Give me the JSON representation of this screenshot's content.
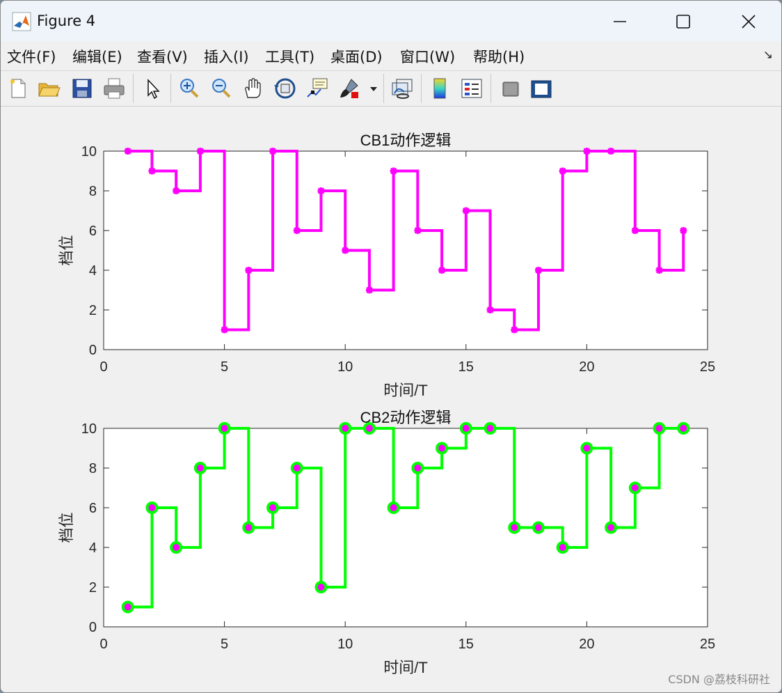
{
  "window": {
    "title": "Figure 4",
    "controls": [
      "minimize",
      "maximize",
      "close"
    ]
  },
  "menu": [
    "文件(F)",
    "编辑(E)",
    "查看(V)",
    "插入(I)",
    "工具(T)",
    "桌面(D)",
    "窗口(W)",
    "帮助(H)"
  ],
  "menu_dock_arrow": "↘",
  "toolbar": [
    "new-figure-icon",
    "open-file-icon",
    "save-icon",
    "print-icon",
    "select-arrow-icon",
    "zoom-in-icon",
    "zoom-out-icon",
    "pan-hand-icon",
    "rotate-3d-icon",
    "data-cursor-icon",
    "brush-icon",
    "link-plot-icon",
    "colorbar-icon",
    "legend-icon",
    "hide-plot-tools-icon",
    "show-plot-tools-icon"
  ],
  "watermark": "CSDN @荔枝科研社",
  "chart_data": [
    {
      "type": "line",
      "step": true,
      "title": "CB1动作逻辑",
      "xlabel": "时间/T",
      "ylabel": "档位",
      "xlim": [
        0,
        25
      ],
      "ylim": [
        0,
        10
      ],
      "xticks": [
        0,
        5,
        10,
        15,
        20,
        25
      ],
      "yticks": [
        0,
        2,
        4,
        6,
        8,
        10
      ],
      "line_color": "#ff00ff",
      "marker": "star",
      "marker_color": "#ff00ff",
      "x": [
        1,
        2,
        3,
        4,
        5,
        6,
        7,
        8,
        9,
        10,
        11,
        12,
        13,
        14,
        15,
        16,
        17,
        18,
        19,
        20,
        21,
        22,
        23,
        24
      ],
      "y": [
        10,
        9,
        8,
        10,
        1,
        4,
        10,
        6,
        8,
        5,
        3,
        9,
        6,
        4,
        7,
        2,
        1,
        4,
        9,
        10,
        10,
        6,
        4,
        6
      ]
    },
    {
      "type": "line",
      "step": true,
      "title": "CB2动作逻辑",
      "xlabel": "时间/T",
      "ylabel": "档位",
      "xlim": [
        0,
        25
      ],
      "ylim": [
        0,
        10
      ],
      "xticks": [
        0,
        5,
        10,
        15,
        20,
        25
      ],
      "yticks": [
        0,
        2,
        4,
        6,
        8,
        10
      ],
      "line_color": "#00ff00",
      "marker": "circle",
      "marker_edge_color": "#00ff00",
      "marker_face_color": "#ff00ff",
      "x": [
        1,
        2,
        3,
        4,
        5,
        6,
        7,
        8,
        9,
        10,
        11,
        12,
        13,
        14,
        15,
        16,
        17,
        18,
        19,
        20,
        21,
        22,
        23,
        24
      ],
      "y": [
        1,
        6,
        4,
        8,
        10,
        5,
        6,
        8,
        2,
        10,
        10,
        6,
        8,
        9,
        10,
        10,
        5,
        5,
        4,
        9,
        5,
        7,
        10,
        10
      ]
    }
  ]
}
